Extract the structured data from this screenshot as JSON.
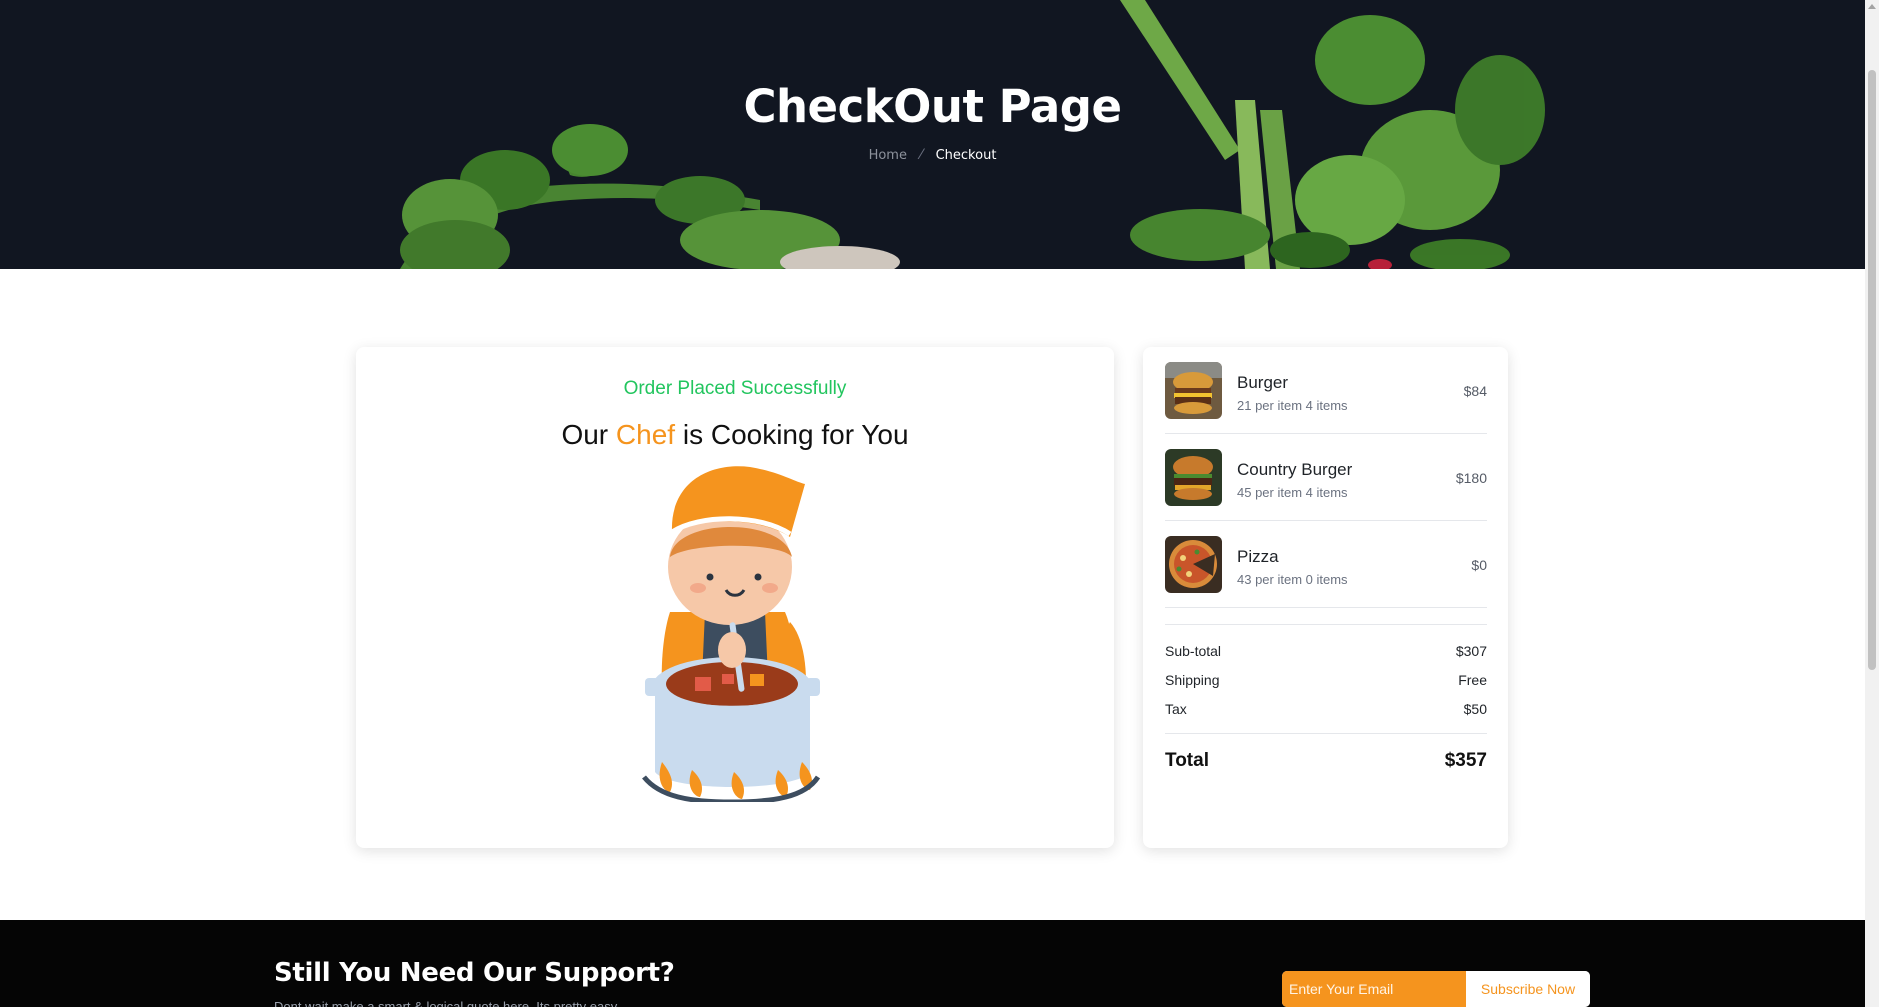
{
  "hero": {
    "title": "CheckOut Page",
    "breadcrumb": {
      "home": "Home",
      "separator": "⁄",
      "current": "Checkout"
    }
  },
  "success": {
    "message": "Order Placed Successfully",
    "title_prefix": "Our ",
    "title_highlight": "Chef",
    "title_suffix": " is Cooking for You"
  },
  "order": {
    "items": [
      {
        "name": "Burger",
        "meta": "21 per item 4 items",
        "price": "$84",
        "thumb_icon": "burger-photo"
      },
      {
        "name": "Country Burger",
        "meta": "45 per item 4 items",
        "price": "$180",
        "thumb_icon": "country-burger-photo"
      },
      {
        "name": "Pizza",
        "meta": "43 per item 0 items",
        "price": "$0",
        "thumb_icon": "pizza-photo"
      }
    ],
    "subtotal_label": "Sub-total",
    "subtotal_value": "$307",
    "shipping_label": "Shipping",
    "shipping_value": "Free",
    "tax_label": "Tax",
    "tax_value": "$50",
    "total_label": "Total",
    "total_value": "$357"
  },
  "support": {
    "title": "Still You Need Our Support?",
    "subtitle": "Dont wait make a smart & logical quote here. Its pretty easy.",
    "email_placeholder": "Enter Your Email",
    "subscribe_label": "Subscribe Now"
  },
  "colors": {
    "accent": "#f5941e",
    "success": "#22c55e",
    "hero_bg": "#111621",
    "footer_bg": "#050505"
  }
}
